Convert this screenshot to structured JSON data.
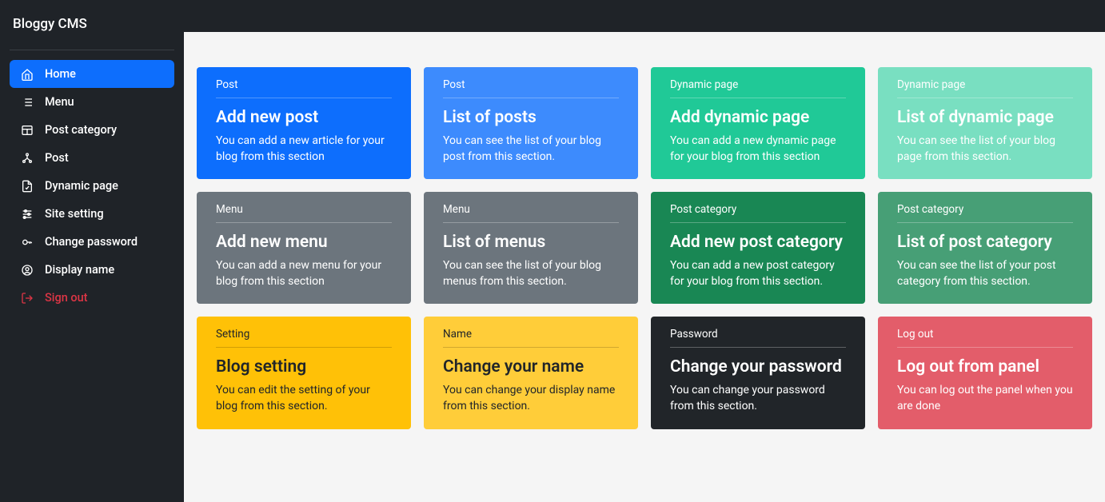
{
  "brand": "Bloggy CMS",
  "sidebar": {
    "items": [
      {
        "label": "Home",
        "icon": "home-icon"
      },
      {
        "label": "Menu",
        "icon": "list-icon"
      },
      {
        "label": "Post category",
        "icon": "layout-icon"
      },
      {
        "label": "Post",
        "icon": "nodes-icon"
      },
      {
        "label": "Dynamic page",
        "icon": "file-check-icon"
      },
      {
        "label": "Site setting",
        "icon": "sliders-icon"
      },
      {
        "label": "Change password",
        "icon": "key-icon"
      },
      {
        "label": "Display name",
        "icon": "user-circle-icon"
      },
      {
        "label": "Sign out",
        "icon": "signout-icon"
      }
    ]
  },
  "cards": [
    {
      "cat": "Post",
      "title": "Add new post",
      "desc": "You can add a new article for your blog from this section",
      "cls": "c-blue1"
    },
    {
      "cat": "Post",
      "title": "List of posts",
      "desc": "You can see the list of your blog post from this section.",
      "cls": "c-blue2"
    },
    {
      "cat": "Dynamic page",
      "title": "Add dynamic page",
      "desc": "You can add a new dynamic page for your blog from this section",
      "cls": "c-teal1"
    },
    {
      "cat": "Dynamic page",
      "title": "List of dynamic page",
      "desc": "You can see the list of your blog page from this section.",
      "cls": "c-teal2"
    },
    {
      "cat": "Menu",
      "title": "Add new menu",
      "desc": "You can add a new menu for your blog from this section",
      "cls": "c-gray1"
    },
    {
      "cat": "Menu",
      "title": "List of menus",
      "desc": "You can see the list of your blog menus from this section.",
      "cls": "c-gray2"
    },
    {
      "cat": "Post category",
      "title": "Add new post category",
      "desc": "You can add a new post category for your blog from this section.",
      "cls": "c-green1"
    },
    {
      "cat": "Post category",
      "title": "List of post category",
      "desc": "You can see the list of your post category from this section.",
      "cls": "c-green2"
    },
    {
      "cat": "Setting",
      "title": "Blog setting",
      "desc": "You can edit the setting of your blog from this section.",
      "cls": "c-yellow1"
    },
    {
      "cat": "Name",
      "title": "Change your name",
      "desc": "You can change your display name from this section.",
      "cls": "c-yellow2"
    },
    {
      "cat": "Password",
      "title": "Change your password",
      "desc": "You can change your password from this section.",
      "cls": "c-dark"
    },
    {
      "cat": "Log out",
      "title": "Log out from panel",
      "desc": "You can log out the panel when you are done",
      "cls": "c-red"
    }
  ]
}
